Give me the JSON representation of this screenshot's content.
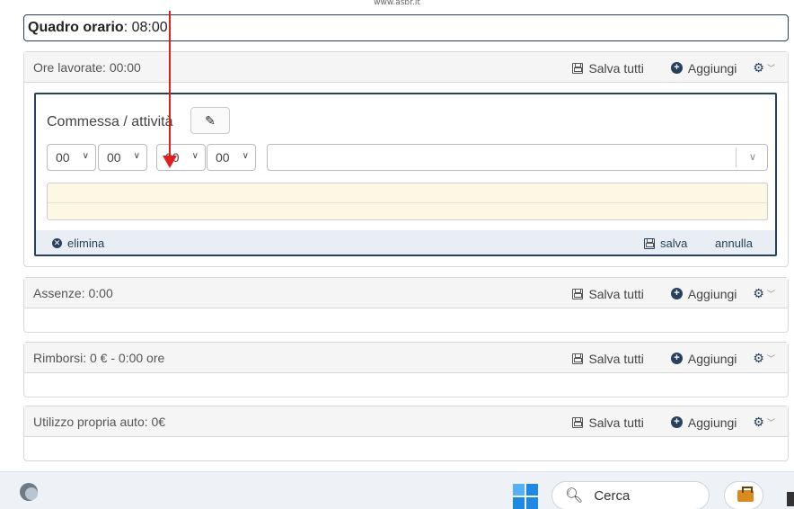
{
  "url_hint": "www.asbr.it",
  "quadro_orario": {
    "label": "Quadro orario",
    "value": ": 08:00"
  },
  "panels": [
    {
      "title": "Ore lavorate: 00:00"
    },
    {
      "title": "Assenze: 0:00"
    },
    {
      "title": "Rimborsi: 0 € - 0:00 ore"
    },
    {
      "title": "Utilizzo propria auto: 0€"
    }
  ],
  "actions": {
    "save_all": "Salva tutti",
    "add": "Aggiungi"
  },
  "entry": {
    "label": "Commessa / attività",
    "selects": [
      "00",
      "00",
      "00",
      "00"
    ],
    "combo_value": "",
    "delete_label": "elimina",
    "save_label": "salva",
    "cancel_label": "annulla"
  },
  "taskbar": {
    "search_label": "Cerca"
  },
  "colors": {
    "accent": "#27405e",
    "arrow": "#e02020",
    "notes_bg": "#fdf8e3"
  }
}
